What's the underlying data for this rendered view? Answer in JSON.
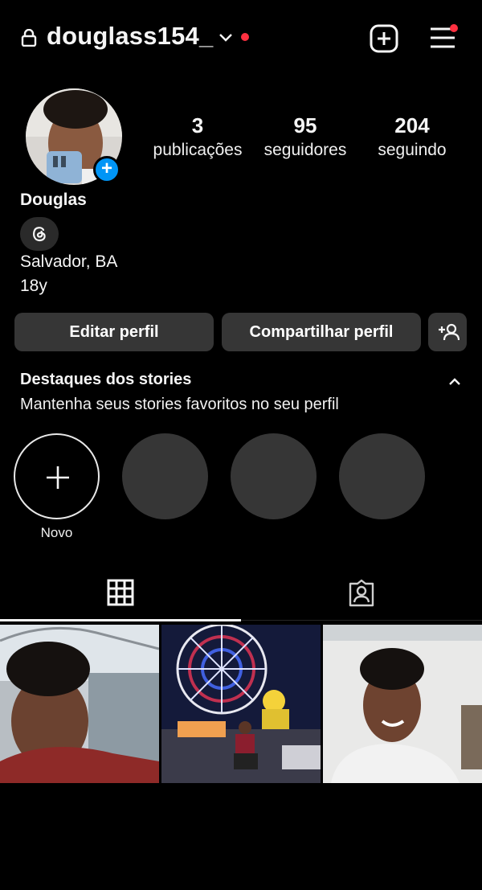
{
  "header": {
    "username": "douglass154_",
    "icons": [
      "lock-icon",
      "chevron-down-icon",
      "notification-dot",
      "create-icon",
      "menu-icon"
    ],
    "accent_red": "#ff3040"
  },
  "profile": {
    "display_name": "Douglas",
    "location": "Salvador, BA",
    "age": "18y",
    "add_story_symbol": "+",
    "accent_blue": "#0095f6"
  },
  "stats": [
    {
      "count": "3",
      "label": "publicações"
    },
    {
      "count": "95",
      "label": "seguidores"
    },
    {
      "count": "204",
      "label": "seguindo"
    }
  ],
  "actions": {
    "edit_label": "Editar perfil",
    "share_label": "Compartilhar perfil",
    "add_person_icon": "add-person-icon"
  },
  "highlights": {
    "title": "Destaques dos stories",
    "subtitle": "Mantenha seus stories favoritos no seu perfil",
    "new_label": "Novo"
  },
  "tabs": [
    "grid-icon",
    "tagged-icon"
  ],
  "posts": [
    "selfie",
    "ferris-wheel-night",
    "smiling-portrait"
  ]
}
